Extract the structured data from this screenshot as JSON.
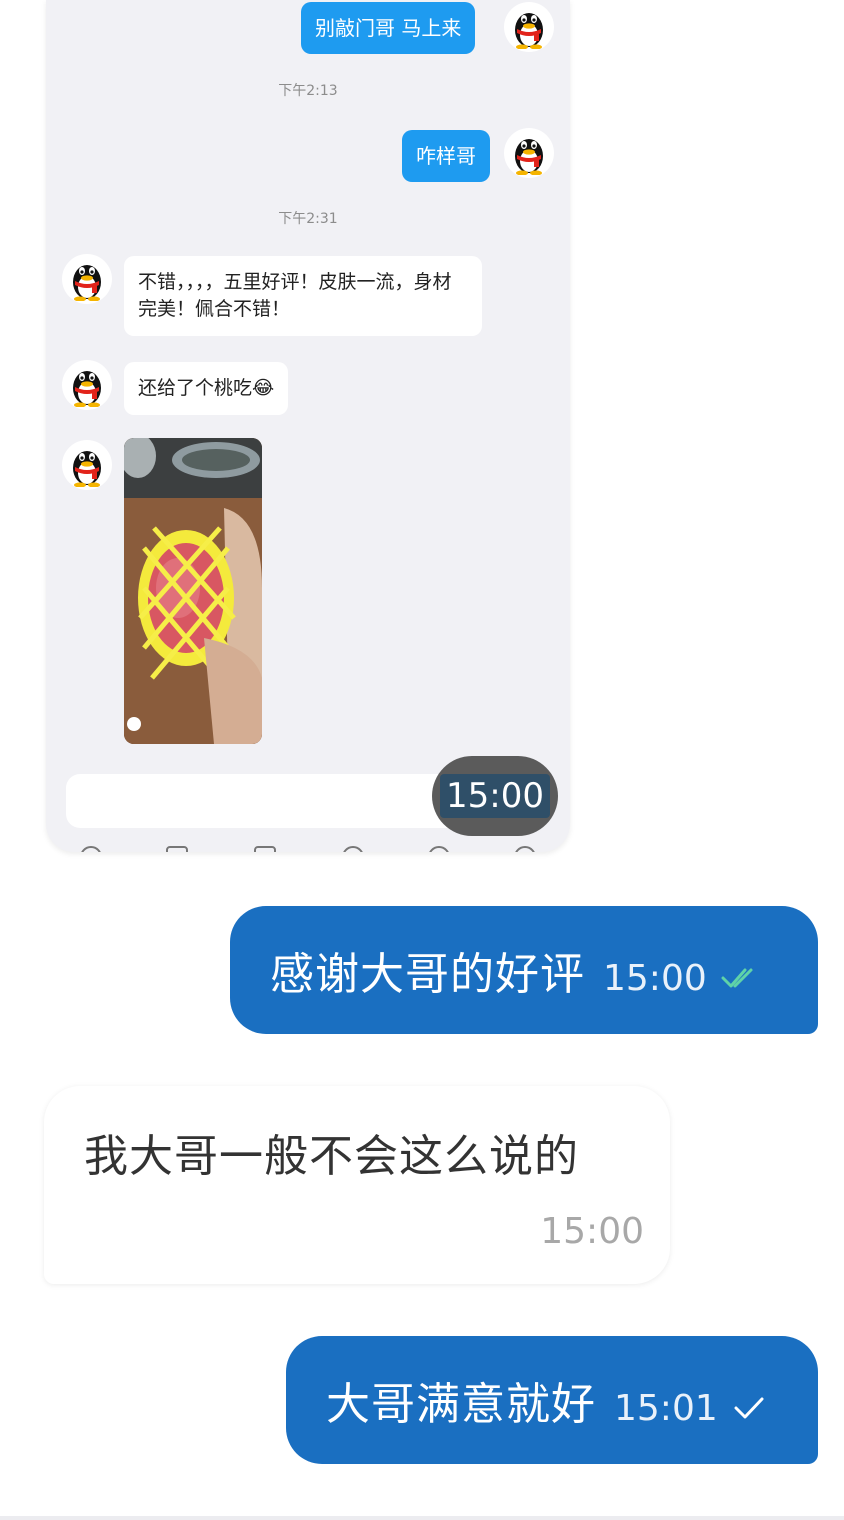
{
  "embedded_qq": {
    "messages": [
      {
        "text": "别敲门哥 马上来"
      },
      {
        "text": "咋样哥"
      },
      {
        "text": "不错，，，，五里好评！皮肤一流，身材完美！佩合不错！"
      },
      {
        "text": "还给了个桃吃😂"
      }
    ],
    "timestamps": [
      "下午2:13",
      "下午2:31"
    ],
    "overlay_time": "15:00"
  },
  "telegram": {
    "messages": [
      {
        "direction": "outgoing",
        "text": "感谢大哥的好评",
        "time": "15:00",
        "status": "read"
      },
      {
        "direction": "incoming",
        "text": "我大哥一般不会这么说的",
        "time": "15:00"
      },
      {
        "direction": "outgoing",
        "text": "大哥满意就好",
        "time": "15:01",
        "status": "sent"
      }
    ]
  },
  "colors": {
    "telegram_outgoing": "#1a6fc1",
    "qq_outgoing": "#1e9bf0",
    "read_check": "#5fd3a8"
  }
}
